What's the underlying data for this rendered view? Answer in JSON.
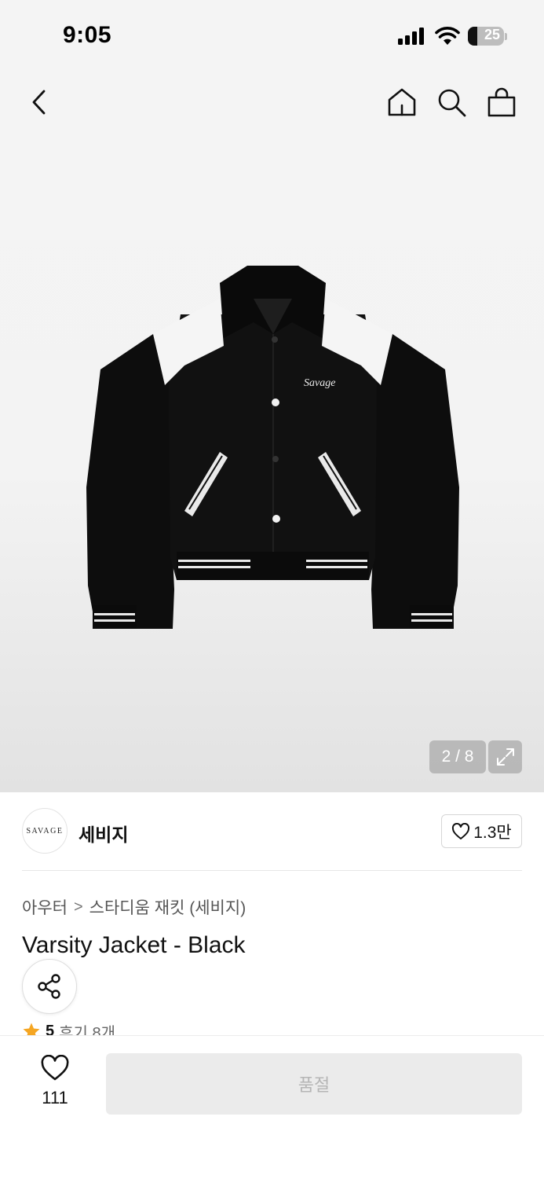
{
  "status_bar": {
    "time": "9:05",
    "battery": "25",
    "battery_level": 0.25
  },
  "nav": {
    "back_icon": "chevron-left-icon",
    "home_icon": "home-icon",
    "search_icon": "search-icon",
    "bag_icon": "shopping-bag-icon"
  },
  "gallery": {
    "counter": "2 / 8",
    "current": 2,
    "total": 8,
    "expand_icon": "expand-icon",
    "image_logo_text": "Savage"
  },
  "brand": {
    "logo_text": "SAVAGE",
    "name": "세비지",
    "likes": "1.3만",
    "like_icon": "heart-outline-icon"
  },
  "breadcrumb": {
    "items": [
      "아우터",
      "스타디움 재킷 (세비지)"
    ],
    "separator": ">"
  },
  "product": {
    "title": "Varsity Jacket - Black",
    "rating": "5",
    "reviews": "후기 8개",
    "star_color": "#f5a623"
  },
  "share_icon": "share-icon",
  "bottom": {
    "wish_count": "111",
    "wish_icon": "heart-outline-icon",
    "buy_label": "품절"
  }
}
